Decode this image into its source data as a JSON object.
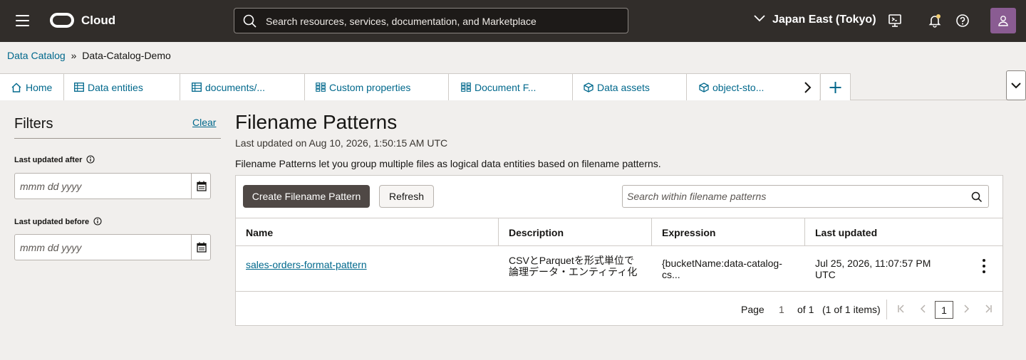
{
  "topbar": {
    "brand": "Cloud",
    "search_placeholder": "Search resources, services, documentation, and Marketplace",
    "region": "Japan East (Tokyo)"
  },
  "breadcrumb": {
    "parent": "Data Catalog",
    "separator": "»",
    "current": "Data-Catalog-Demo"
  },
  "tabs": [
    {
      "label": "Home",
      "icon": "home-icon"
    },
    {
      "label": "Data entities",
      "icon": "table-icon"
    },
    {
      "label": "documents/...",
      "icon": "table-icon"
    },
    {
      "label": "Custom properties",
      "icon": "grid-icon"
    },
    {
      "label": "Document F...",
      "icon": "grid-icon"
    },
    {
      "label": "Data assets",
      "icon": "cube-icon"
    },
    {
      "label": "object-sto...",
      "icon": "cube-icon"
    }
  ],
  "filters": {
    "title": "Filters",
    "clear": "Clear",
    "after_label": "Last updated after",
    "before_label": "Last updated before",
    "date_placeholder": "mmm dd yyyy"
  },
  "main": {
    "title": "Filename Patterns",
    "last_updated": "Last updated on Aug 10, 2026, 1:50:15 AM UTC",
    "description": "Filename Patterns let you group multiple files as logical data entities based on filename patterns.",
    "create_button": "Create Filename Pattern",
    "refresh_button": "Refresh",
    "search_placeholder": "Search within filename patterns"
  },
  "table": {
    "columns": [
      "Name",
      "Description",
      "Expression",
      "Last updated"
    ],
    "rows": [
      {
        "name": "sales-orders-format-pattern",
        "description_l1": "CSVとParquetを形式単位で",
        "description_l2": "論理データ・エンティティ化",
        "expression_l1": "{bucketName:data-catalog-",
        "expression_l2": "cs...",
        "updated_l1": "Jul 25, 2026, 11:07:57 PM",
        "updated_l2": "UTC"
      }
    ]
  },
  "pager": {
    "page_label": "Page",
    "page_value": "1",
    "of_label": "of 1",
    "items_label": "(1 of 1 items)",
    "current_page": "1"
  }
}
